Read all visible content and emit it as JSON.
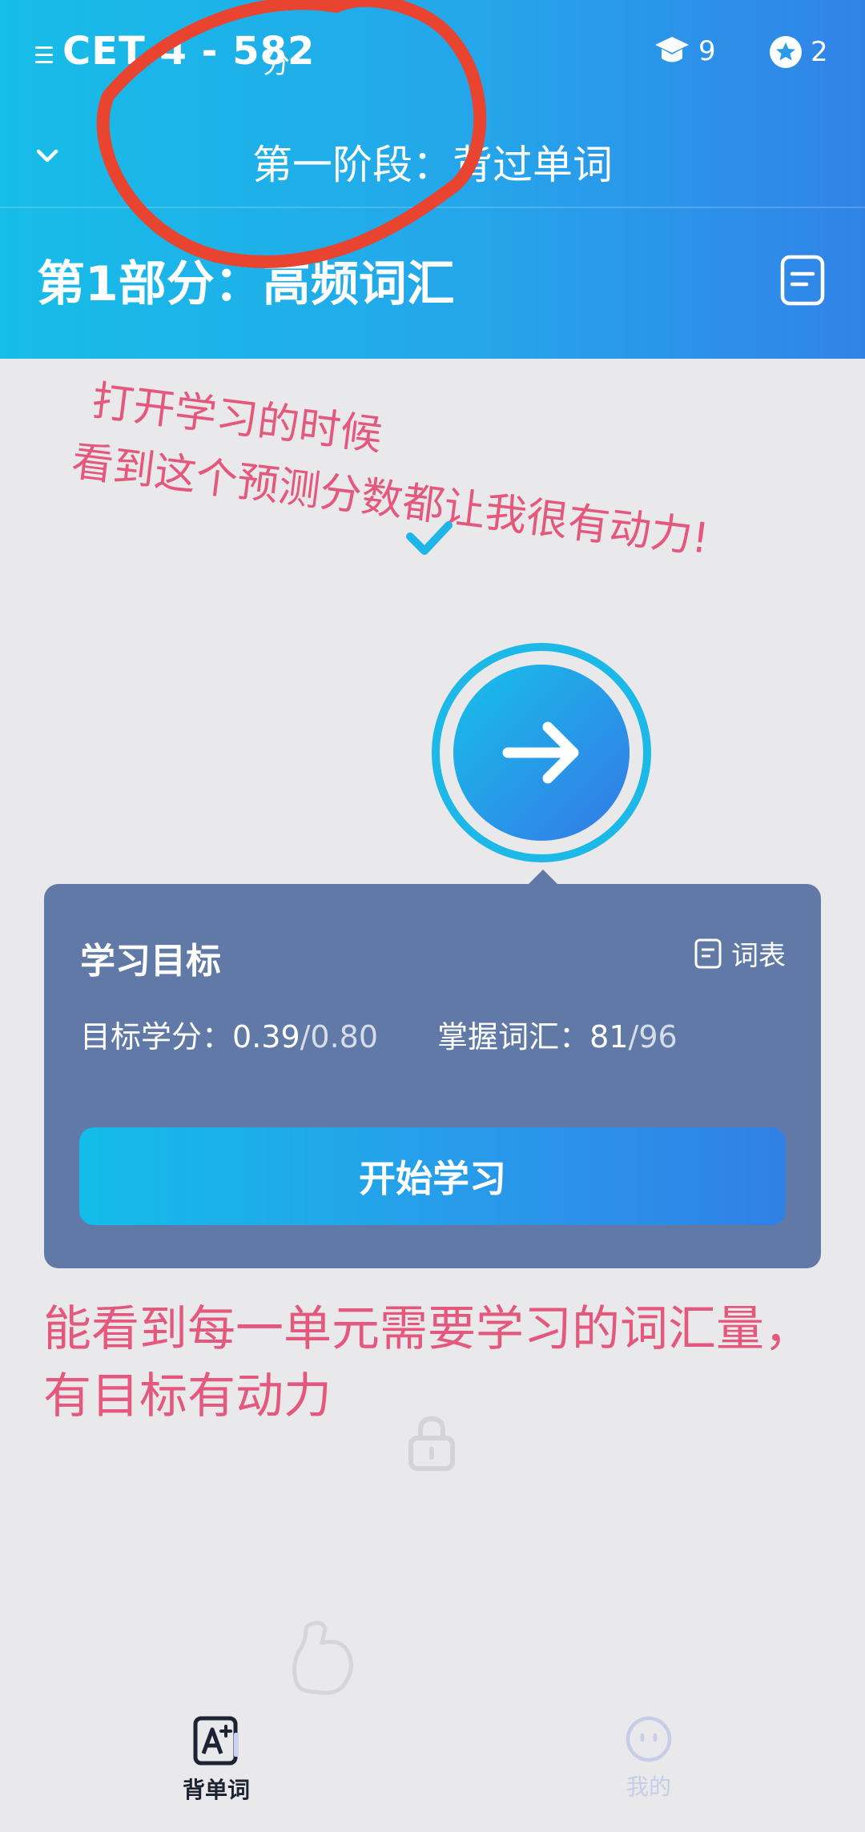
{
  "header": {
    "exam_title": "CET 4 - 582",
    "score_unit": "分",
    "courses_count": "9",
    "stars_count": "2",
    "stage_title": "第一阶段：背过单词",
    "part_title": "第1部分：高频词汇"
  },
  "annotations": {
    "top_line1": "打开学习的时候",
    "top_line2": "看到这个预测分数都让我很有动力!",
    "bottom_line1": "能看到每一单元需要学习的词汇量，",
    "bottom_line2": "有目标有动力"
  },
  "goal_card": {
    "title": "学习目标",
    "wordlist_label": "词表",
    "credit_label": "目标学分：",
    "credit_value": "0.39",
    "credit_total": "/0.80",
    "vocab_label": "掌握词汇：",
    "vocab_value": "81",
    "vocab_total": "/96",
    "start_button": "开始学习"
  },
  "bottom_nav": {
    "learn_label": "背单词",
    "me_label": "我的"
  },
  "colors": {
    "header_start": "#16bde8",
    "header_end": "#3183e8",
    "card_bg": "#6079a6",
    "annotation": "#e3587c",
    "red_circle": "#e8442f",
    "page_bg": "#e9e8ea"
  },
  "icons": [
    "menu-icon",
    "graduation-cap-icon",
    "star-badge-icon",
    "chevron-down-icon",
    "document-icon",
    "check-icon",
    "arrow-right-icon",
    "lock-icon",
    "flexed-arm-icon",
    "vocab-card-icon",
    "face-icon"
  ]
}
